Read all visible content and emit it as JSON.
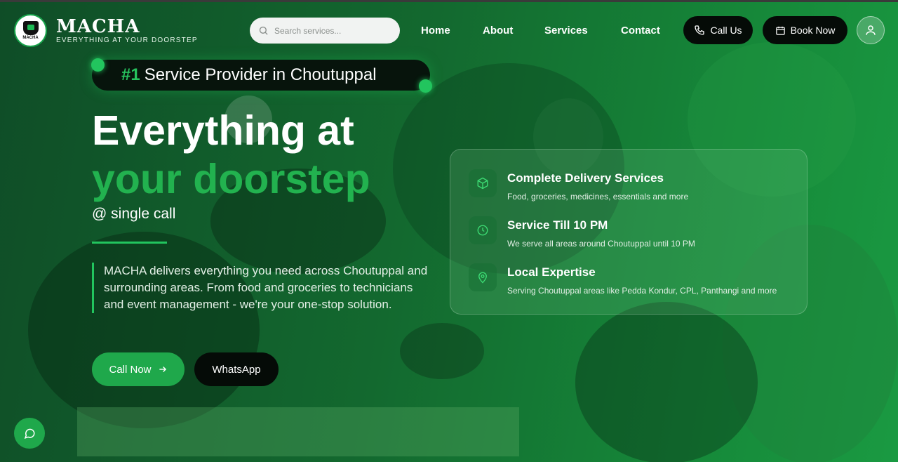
{
  "brand": {
    "name": "MACHA",
    "tagline": "EVERYTHING AT YOUR DOORSTEP",
    "badge_text": "MACHA"
  },
  "search": {
    "placeholder": "Search services..."
  },
  "nav": {
    "items": [
      {
        "label": "Home"
      },
      {
        "label": "About"
      },
      {
        "label": "Services"
      },
      {
        "label": "Contact"
      }
    ],
    "call_us": "Call Us",
    "book_now": "Book Now"
  },
  "hero": {
    "badge_rank": "#1",
    "badge_text": "Service Provider in Choutuppal",
    "title_line1": "Everything at",
    "title_line2": "your doorstep",
    "subtitle": "@ single call",
    "description": "MACHA delivers everything you need across Choutuppal and surrounding areas. From food and groceries to technicians and event management - we're your one-stop solution.",
    "cta_call": "Call Now",
    "cta_whatsapp": "WhatsApp"
  },
  "features": [
    {
      "icon": "box-icon",
      "title": "Complete Delivery Services",
      "desc": "Food, groceries, medicines, essentials and more"
    },
    {
      "icon": "clock-icon",
      "title": "Service Till 10 PM",
      "desc": "We serve all areas around Choutuppal until 10 PM"
    },
    {
      "icon": "map-pin-icon",
      "title": "Local Expertise",
      "desc": "Serving Choutuppal areas like Pedda Kondur, CPL, Panthangi and more"
    }
  ],
  "colors": {
    "accent": "#22c55e",
    "accent_dark": "#1fa84b",
    "button_dark": "#050b07"
  }
}
